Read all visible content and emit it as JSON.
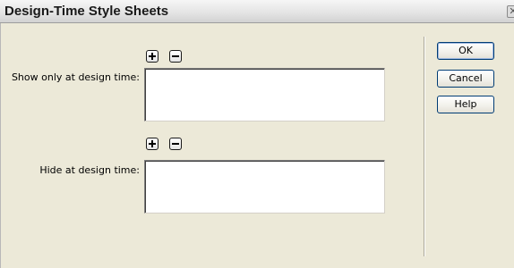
{
  "window": {
    "title": "Design-Time Style Sheets"
  },
  "show_section": {
    "label": "Show only at design time:",
    "add_icon": "plus-icon",
    "remove_icon": "minus-icon",
    "items": []
  },
  "hide_section": {
    "label": "Hide at design time:",
    "add_icon": "plus-icon",
    "remove_icon": "minus-icon",
    "items": []
  },
  "buttons": {
    "ok": "OK",
    "cancel": "Cancel",
    "help": "Help"
  }
}
